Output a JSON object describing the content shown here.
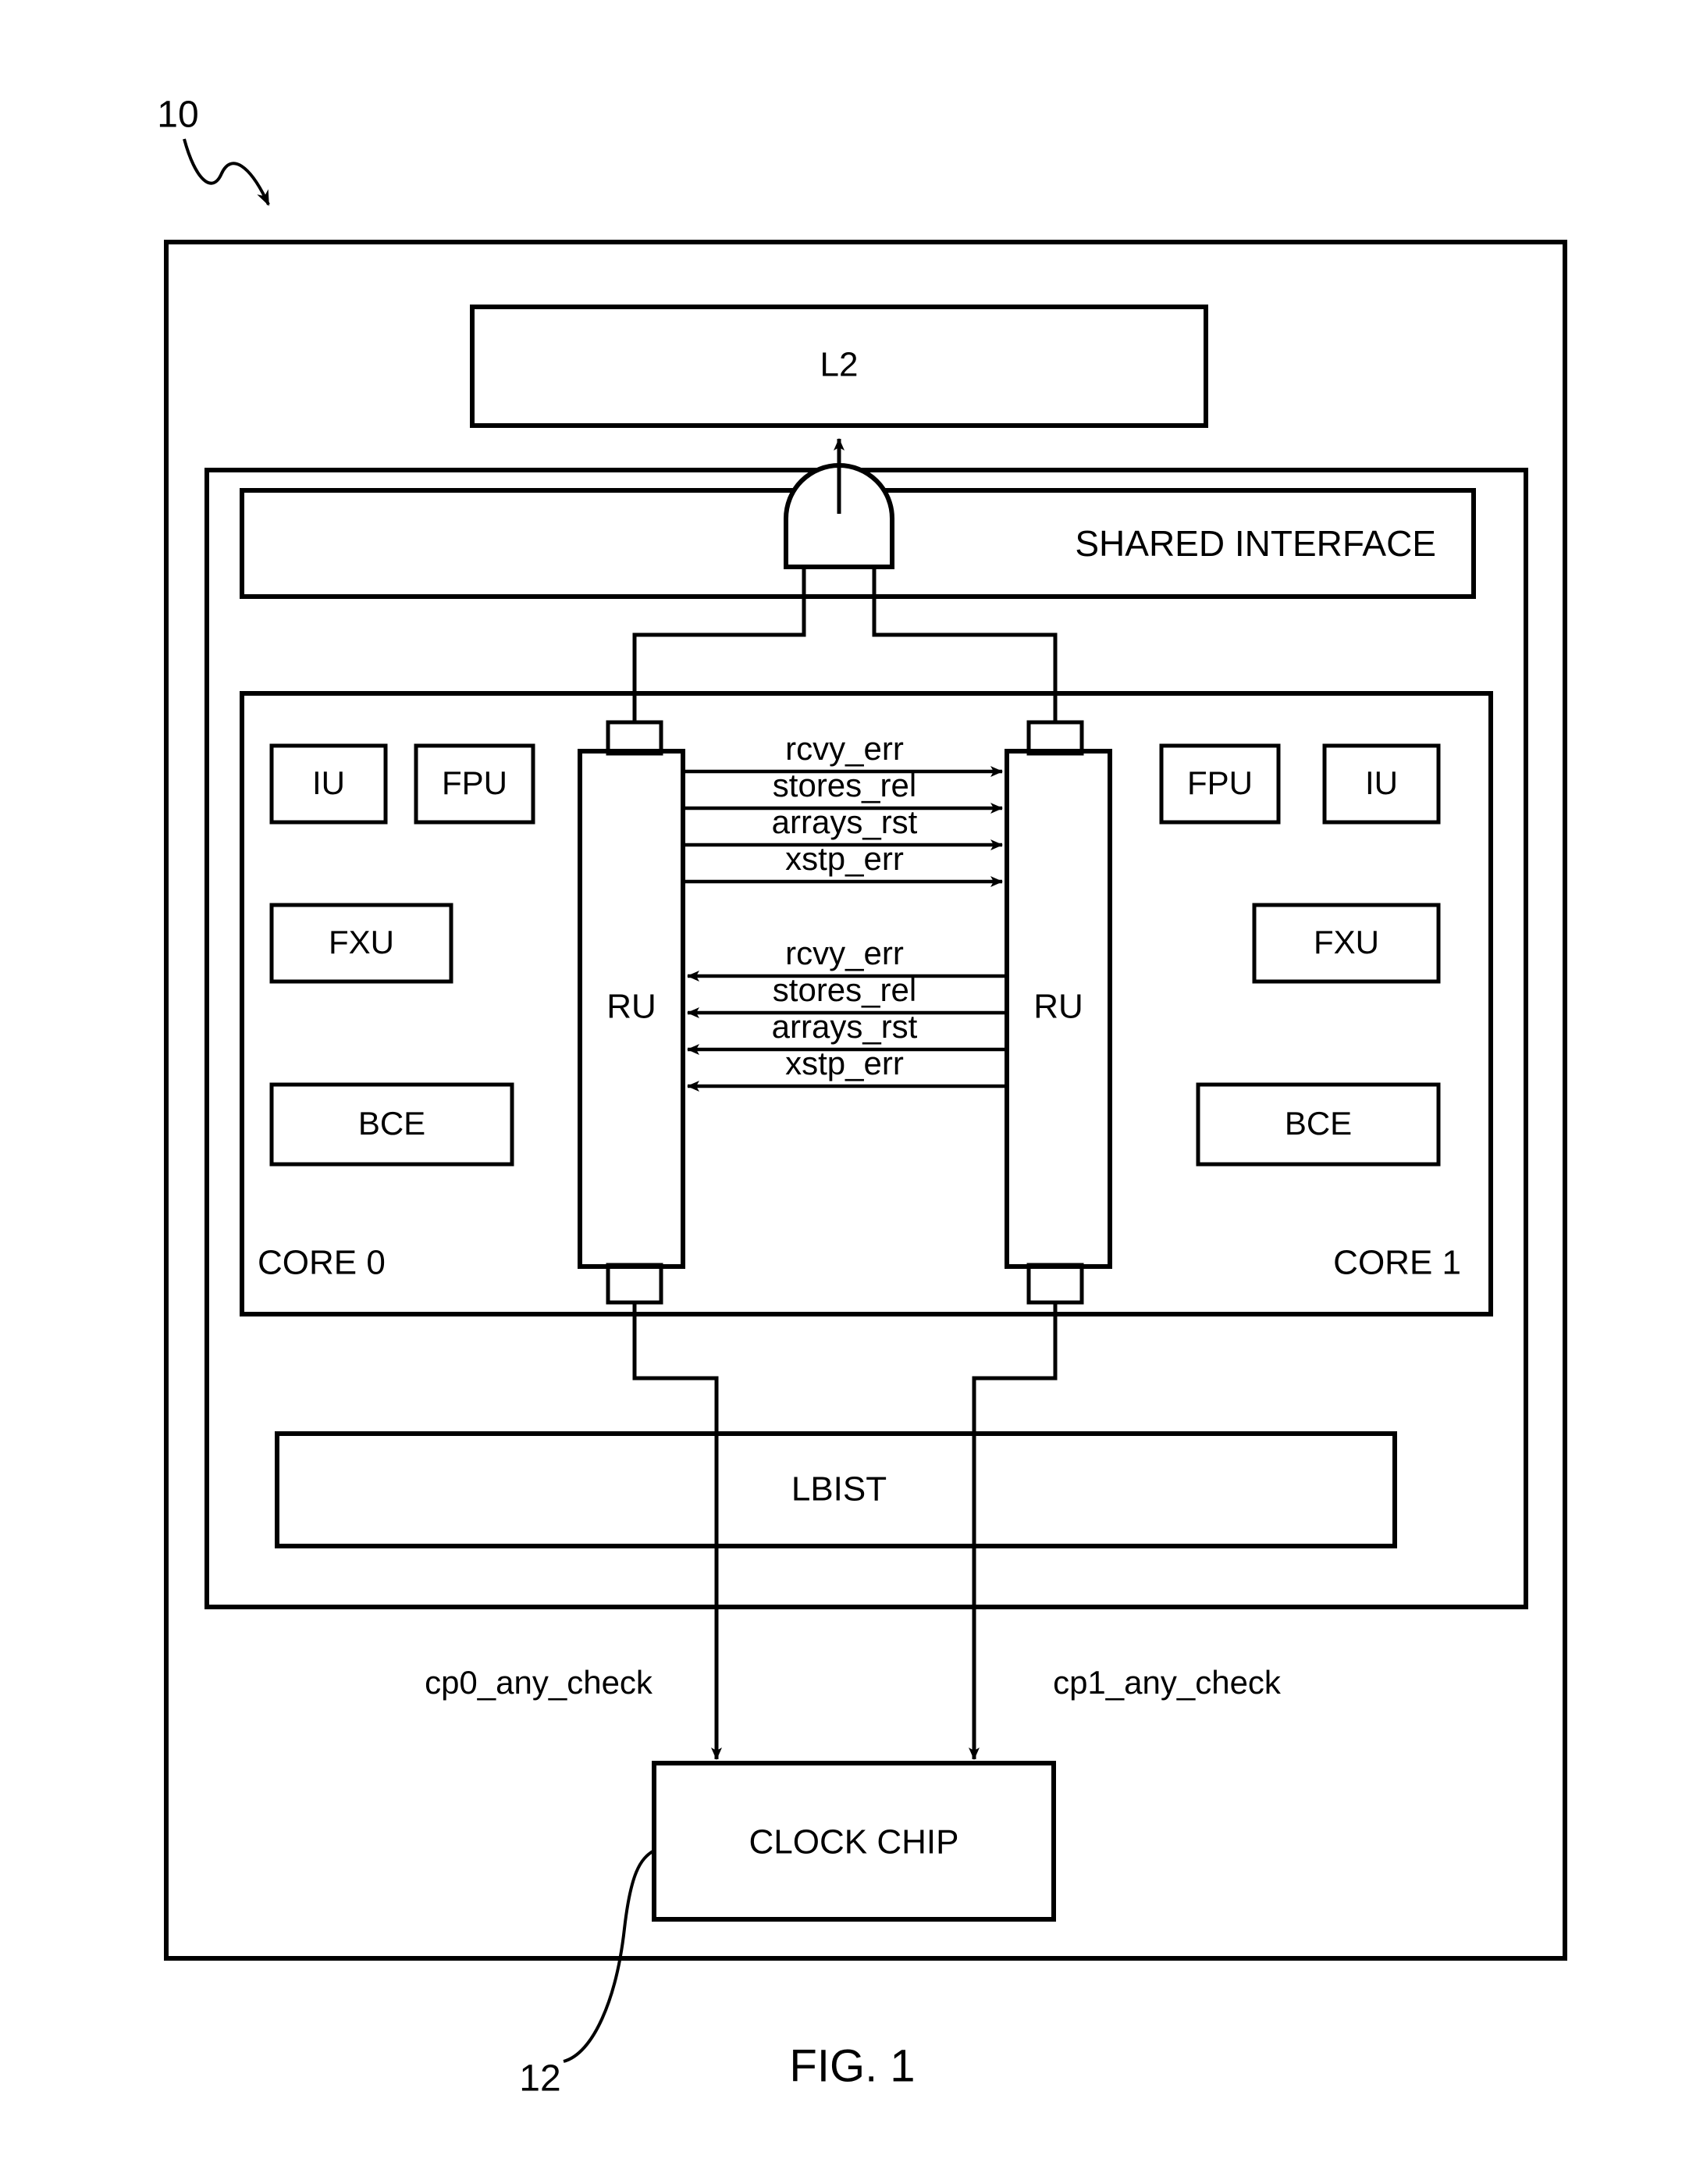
{
  "figure": {
    "caption": "FIG. 1",
    "ref_numeral_top": "10",
    "ref_numeral_bottom": "12"
  },
  "blocks": {
    "l2": "L2",
    "shared_interface": "SHARED INTERFACE",
    "lbist": "LBIST",
    "clock_chip": "CLOCK CHIP",
    "ru_left": "RU",
    "ru_right": "RU"
  },
  "core0": {
    "label": "CORE 0",
    "units": [
      "IU",
      "FPU",
      "FXU",
      "BCE"
    ]
  },
  "core1": {
    "label": "CORE 1",
    "units": [
      "FPU",
      "IU",
      "FXU",
      "BCE"
    ]
  },
  "signals_left_to_right": [
    "rcvy_err",
    "stores_rel",
    "arrays_rst",
    "xstp_err"
  ],
  "signals_right_to_left": [
    "rcvy_err",
    "stores_rel",
    "arrays_rst",
    "xstp_err"
  ],
  "clock_signals": {
    "left": "cp0_any_check",
    "right": "cp1_any_check"
  },
  "colors": {
    "ink": "#000000",
    "paper": "#ffffff"
  }
}
